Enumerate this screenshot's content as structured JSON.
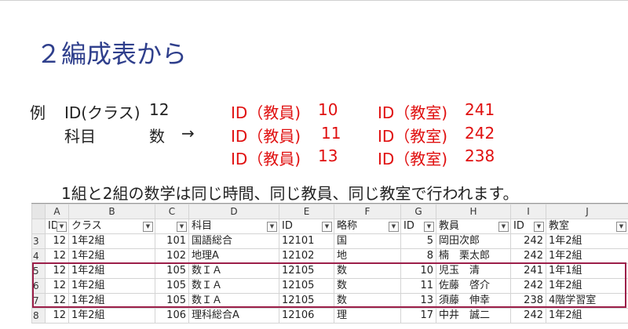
{
  "slide": {
    "title": "２編成表から",
    "example_label": "例",
    "line1": {
      "class_label": "ID(クラス)",
      "class_value": "12",
      "t_label": "ID（教員)",
      "t_value": "10",
      "r_label": "ID（教室)",
      "r_value": "241"
    },
    "line2": {
      "subject_label": "科目",
      "subject_value": "数",
      "arrow": "→",
      "t_label": "ID（教員)",
      "t_value": "11",
      "r_label": "ID（教室)",
      "r_value": "242"
    },
    "line3": {
      "t_label": "ID（教員)",
      "t_value": "13",
      "r_label": "ID（教室)",
      "r_value": "238"
    },
    "sentence": "1組と2組の数学は同じ時間、同じ教員、同じ教室で行われます。"
  },
  "sheet": {
    "col_letters": [
      "A",
      "B",
      "C",
      "D",
      "E",
      "F",
      "G",
      "H",
      "I",
      "J"
    ],
    "headers": [
      "ID",
      "クラス",
      "",
      "科目",
      "ID",
      "略称",
      "ID",
      "教員",
      "ID",
      "教室"
    ],
    "rows": [
      {
        "num": "3",
        "cells": [
          "12",
          "1年2組",
          "101",
          "国語総合",
          "12101",
          "国",
          "5",
          "岡田次郎",
          "242",
          "1年2組"
        ]
      },
      {
        "num": "4",
        "cells": [
          "12",
          "1年2組",
          "102",
          "地理A",
          "12102",
          "地",
          "8",
          "楠　栗太郎",
          "242",
          "1年2組"
        ]
      },
      {
        "num": "5",
        "cells": [
          "12",
          "1年2組",
          "105",
          "数ＩＡ",
          "12105",
          "数",
          "10",
          "児玉　清",
          "241",
          "1年1組"
        ]
      },
      {
        "num": "6",
        "cells": [
          "12",
          "1年2組",
          "105",
          "数ＩＡ",
          "12105",
          "数",
          "11",
          "佐藤　啓介",
          "242",
          "1年2組"
        ]
      },
      {
        "num": "7",
        "cells": [
          "12",
          "1年2組",
          "105",
          "数ＩＡ",
          "12105",
          "数",
          "13",
          "須藤　伸幸",
          "238",
          "4階学習室"
        ]
      },
      {
        "num": "8",
        "cells": [
          "12",
          "1年2組",
          "106",
          "理科総合A",
          "12106",
          "理",
          "17",
          "中井　誠二",
          "242",
          "1年2組"
        ]
      }
    ]
  },
  "colors": {
    "title": "#2f3f8c",
    "red_text": "#e01010",
    "highlight_border": "#9c1f49"
  }
}
